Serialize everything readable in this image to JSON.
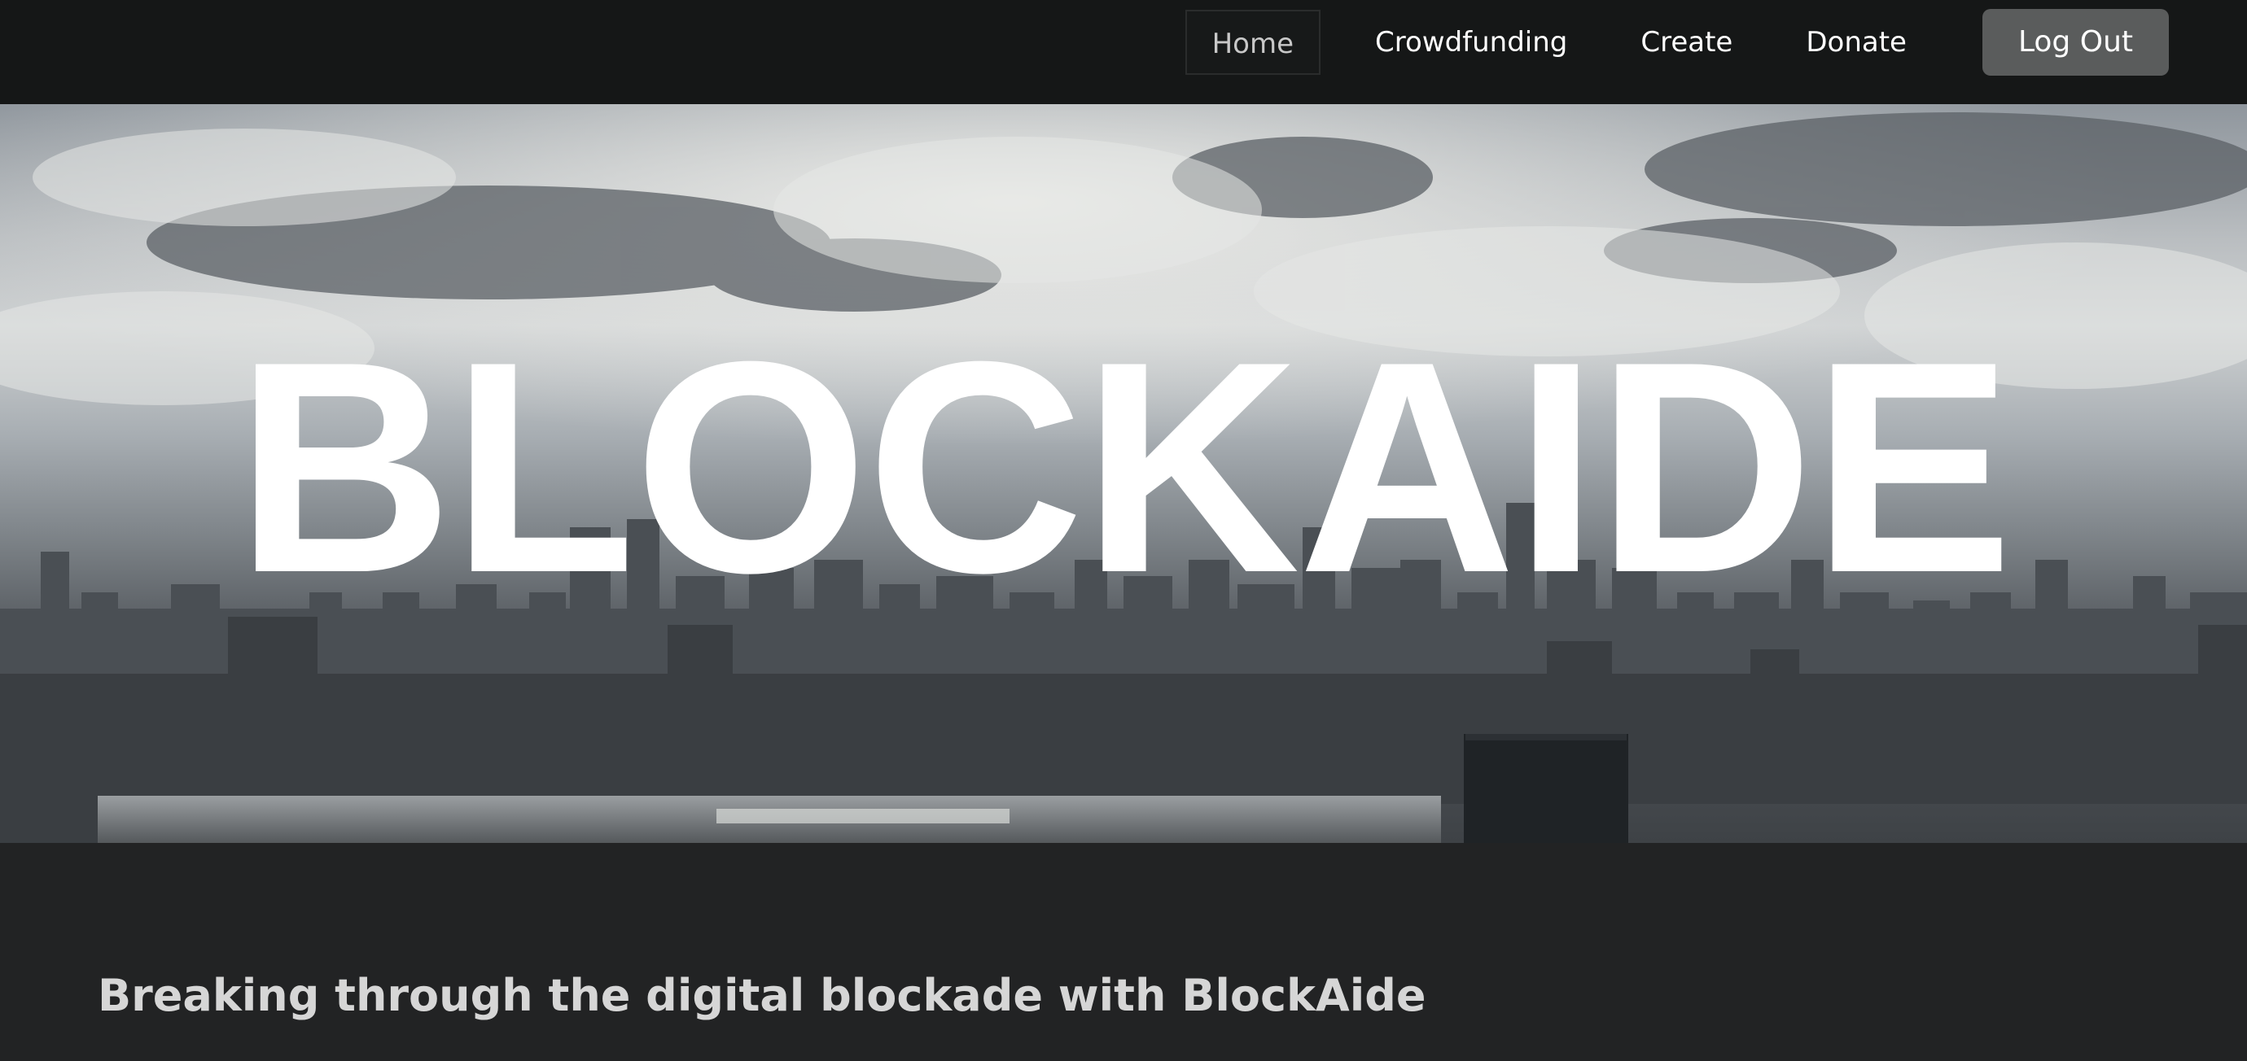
{
  "nav": {
    "items": [
      {
        "label": "Home",
        "active": true
      },
      {
        "label": "Crowdfunding",
        "active": false
      },
      {
        "label": "Create",
        "active": false
      },
      {
        "label": "Donate",
        "active": false
      }
    ],
    "logout_label": "Log Out"
  },
  "hero": {
    "title": "BLOCKAIDE",
    "background": "cloudy city skyline photo"
  },
  "main": {
    "tagline": "Breaking through the digital blockade with BlockAide"
  },
  "colors": {
    "navbar_bg": "#151717",
    "page_bg": "#222324",
    "logout_bg": "#5a5c5c",
    "tagline_text": "#d6d6d6"
  }
}
